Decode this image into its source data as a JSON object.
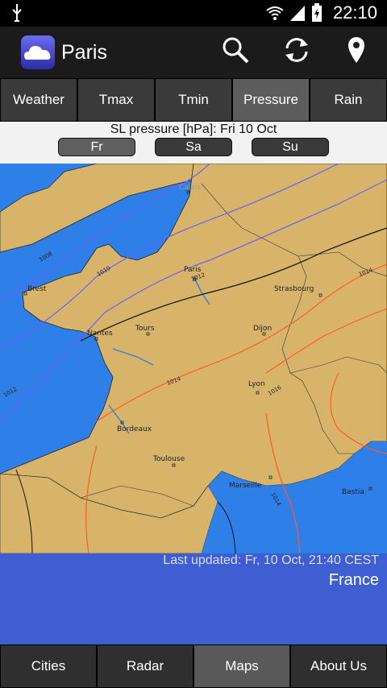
{
  "status": {
    "time": "22:10"
  },
  "app": {
    "title": "Paris"
  },
  "tabs": [
    {
      "label": "Weather"
    },
    {
      "label": "Tmax"
    },
    {
      "label": "Tmin"
    },
    {
      "label": "Pressure",
      "active": true
    },
    {
      "label": "Rain"
    }
  ],
  "map_header": {
    "title": "SL pressure [hPa]: Fri 10 Oct",
    "days": [
      "Fr",
      "Sa",
      "Su"
    ],
    "selected_day": "Fr"
  },
  "map": {
    "cities": [
      "Calais",
      "Paris",
      "Brest",
      "Nantes",
      "Tours",
      "Strasbourg",
      "Dijon",
      "Lyon",
      "Bordeaux",
      "Toulouse",
      "Marseille",
      "Bastia"
    ],
    "isobars": [
      "1008",
      "1010",
      "1012",
      "1012",
      "1014",
      "1014",
      "1016",
      "1014",
      "1014"
    ]
  },
  "footer": {
    "updated": "Last updated: Fr, 10 Oct, 21:40 CEST",
    "region": "France"
  },
  "bottom_nav": [
    {
      "label": "Cities"
    },
    {
      "label": "Radar"
    },
    {
      "label": "Maps",
      "active": true
    },
    {
      "label": "About Us"
    }
  ],
  "colors": {
    "sea": "#2f7fe8",
    "land": "#d8b46a",
    "footer": "#3e5ed2"
  }
}
